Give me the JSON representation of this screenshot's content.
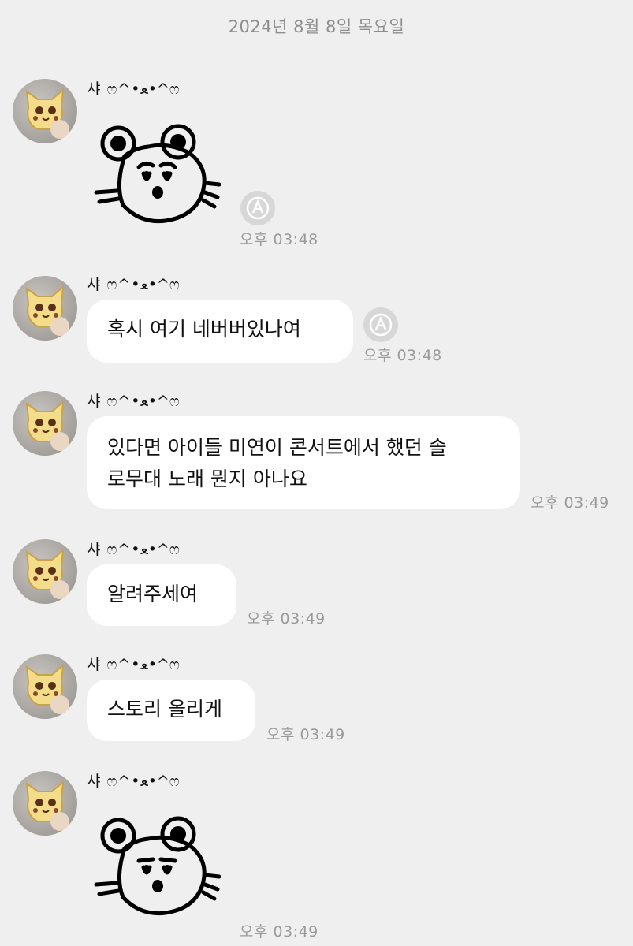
{
  "date_header": "2024년 8월 8일 목요일",
  "messages": [
    {
      "sender": "샤 ෆ^•ﻌ•^ෆ",
      "type": "sticker",
      "sticker": "bear-face-sticker",
      "time": "오후 03:48",
      "translate": true
    },
    {
      "sender": "샤 ෆ^•ﻌ•^ෆ",
      "type": "text",
      "lines": [
        "혹시 여기 네버버있나여"
      ],
      "time": "오후 03:48",
      "translate": true
    },
    {
      "sender": "샤 ෆ^•ﻌ•^ෆ",
      "type": "text",
      "lines": [
        "있다면 아이들 미연이 콘서트에서 했던 솔",
        "로무대 노래 뭔지 아나요"
      ],
      "time": "오후 03:49"
    },
    {
      "sender": "샤 ෆ^•ﻌ•^ෆ",
      "type": "text",
      "lines": [
        "알려주세여"
      ],
      "time": "오후 03:49"
    },
    {
      "sender": "샤 ෆ^•ﻌ•^ෆ",
      "type": "text",
      "lines": [
        "스토리 올리게"
      ],
      "time": "오후 03:49"
    },
    {
      "sender": "샤 ෆ^•ﻌ•^ෆ",
      "type": "sticker",
      "sticker": "bear-face-sticker",
      "time": "오후 03:49"
    }
  ],
  "colors": {
    "background": "#efefef",
    "bubble": "#ffffff",
    "time_text": "#9a9a9a",
    "date_text": "#8e8e8e"
  }
}
